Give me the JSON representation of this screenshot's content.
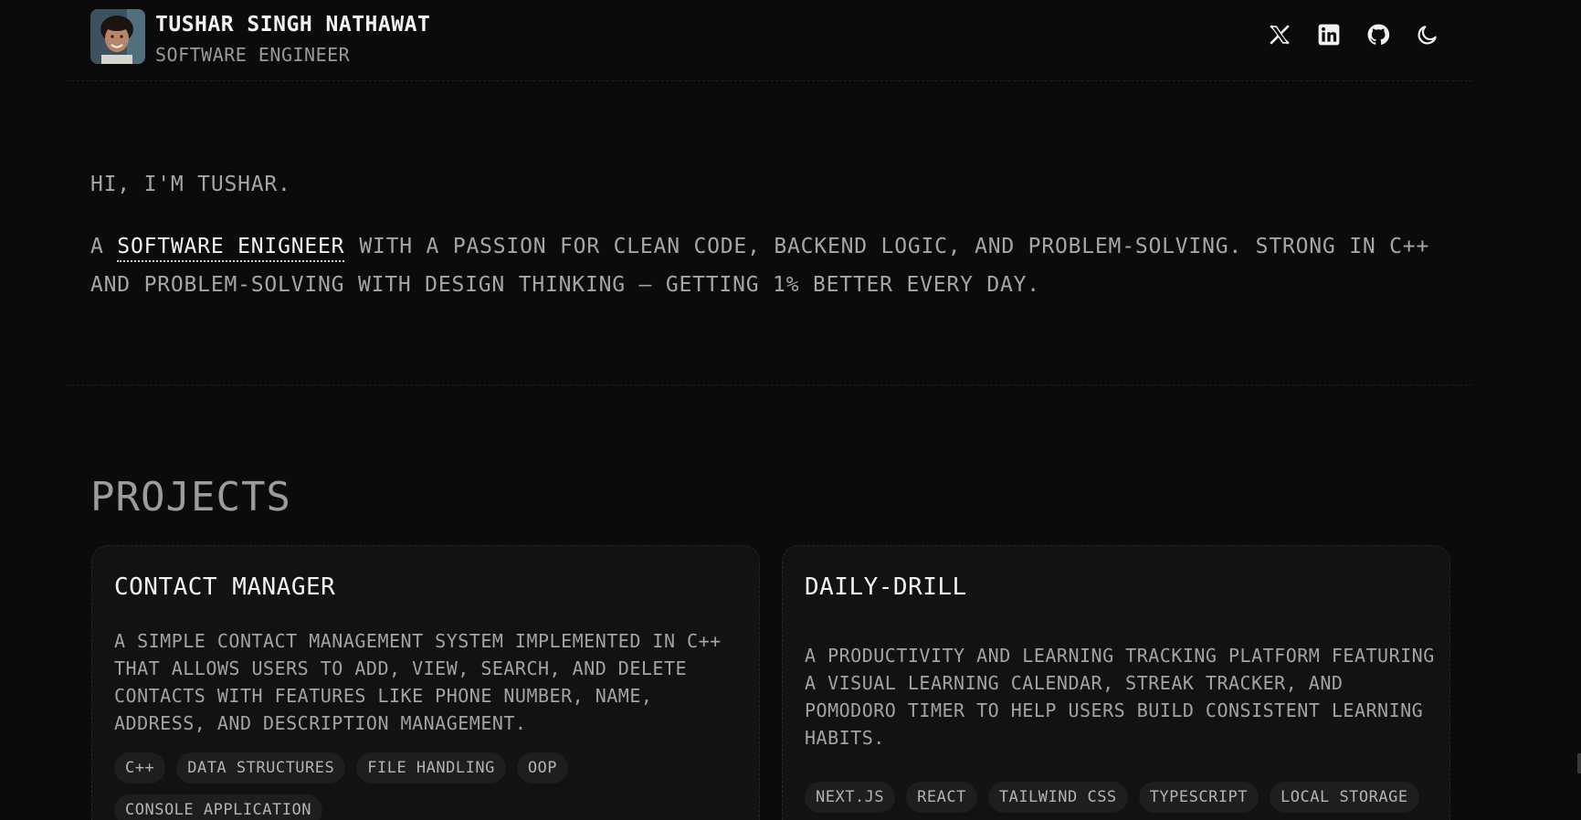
{
  "header": {
    "name": "TUSHAR SINGH NATHAWAT",
    "role": "SOFTWARE ENGINEER",
    "icons": [
      "x-icon",
      "linkedin-icon",
      "github-icon",
      "moon-icon"
    ]
  },
  "hero": {
    "greeting": "HI, I'M TUSHAR.",
    "tagline_prefix": "A ",
    "tagline_highlight": "SOFTWARE ENIGNEER",
    "tagline_rest": "WITH A PASSION FOR CLEAN CODE, BACKEND LOGIC, AND PROBLEM-SOLVING. STRONG IN C++ AND PROBLEM-SOLVING WITH DESIGN THINKING — GETTING 1% BETTER EVERY DAY."
  },
  "projects": {
    "title": "PROJECTS",
    "items": [
      {
        "title": "CONTACT MANAGER",
        "description": "A SIMPLE CONTACT MANAGEMENT SYSTEM IMPLEMENTED IN C++ THAT ALLOWS USERS TO ADD, VIEW, SEARCH, AND DELETE CONTACTS WITH FEATURES LIKE PHONE NUMBER, NAME, ADDRESS, AND DESCRIPTION MANAGEMENT.",
        "tags": [
          "C++",
          "DATA STRUCTURES",
          "FILE HANDLING",
          "OOP",
          "CONSOLE APPLICATION"
        ]
      },
      {
        "title": "DAILY-DRILL",
        "description": "A PRODUCTIVITY AND LEARNING TRACKING PLATFORM FEATURING A VISUAL LEARNING CALENDAR, STREAK TRACKER, AND POMODORO TIMER TO HELP USERS BUILD CONSISTENT LEARNING HABITS.",
        "tags": [
          "NEXT.JS",
          "REACT",
          "TAILWIND CSS",
          "TYPESCRIPT",
          "LOCAL STORAGE"
        ]
      }
    ]
  },
  "colors": {
    "background": "#0b0b0b",
    "card": "#121212",
    "text_primary": "#f2f2f2",
    "text_muted": "#a6a6a6",
    "tag_bg": "#1e1e1e"
  }
}
